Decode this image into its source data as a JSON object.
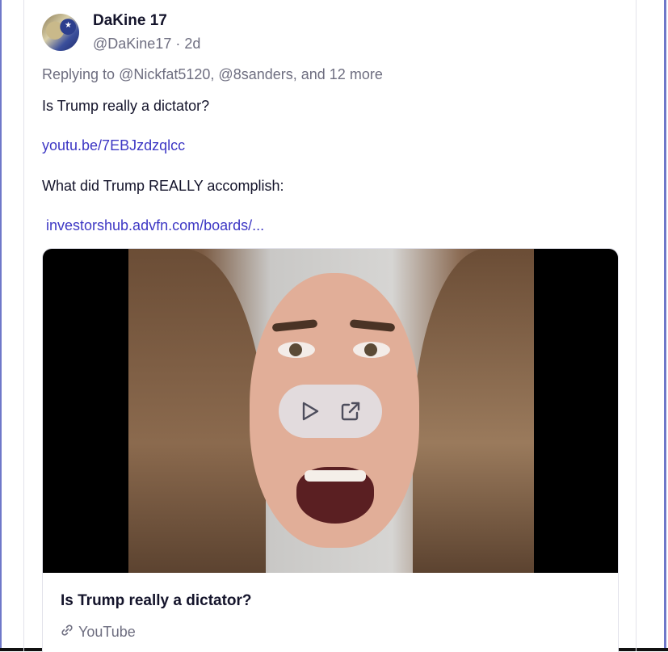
{
  "post": {
    "display_name": "DaKine 17",
    "handle": "@DaKine17",
    "separator": "·",
    "age": "2d",
    "replying_prefix": "Replying to",
    "replying_mention_1": "@Nickfat5120,",
    "replying_mention_2": "@8sanders,",
    "replying_suffix": "and 12 more",
    "line_1": "Is Trump really a dictator?",
    "link_1": "youtu.be/7EBJzdzqlcc",
    "line_2": "What did Trump REALLY accomplish:",
    "link_2": "investorshub.advfn.com/boards/..."
  },
  "card": {
    "title": "Is Trump really a dictator?",
    "source": "YouTube",
    "icons": {
      "play": "play-icon",
      "external": "external-link-icon",
      "link": "link-icon"
    }
  },
  "colors": {
    "link": "#3d37c4",
    "muted": "#6e6e80",
    "text": "#14142b"
  }
}
